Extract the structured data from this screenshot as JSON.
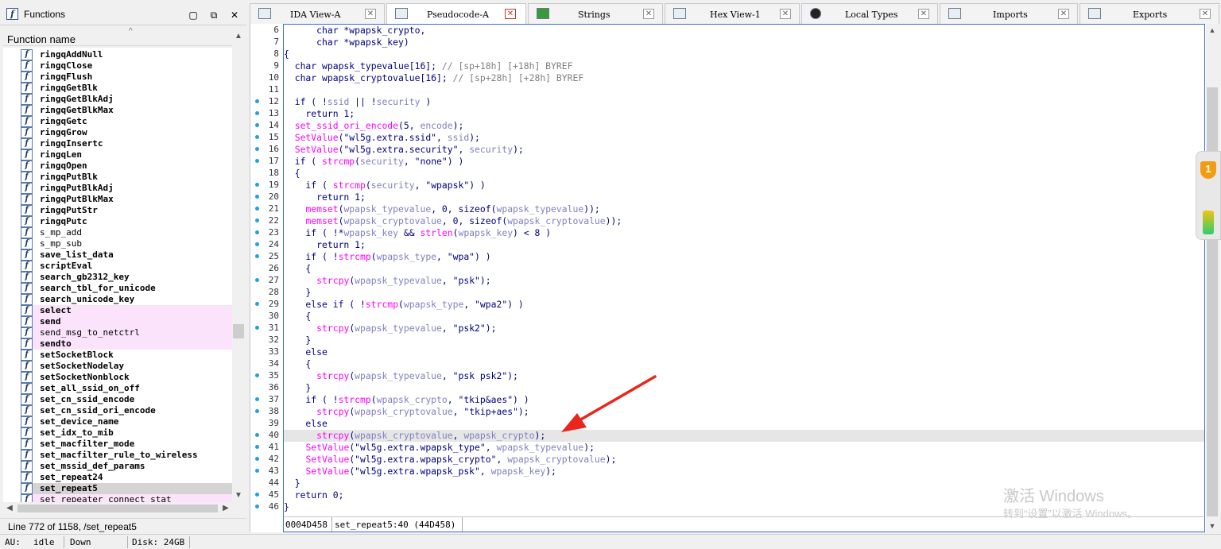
{
  "functions_panel": {
    "title": "Functions",
    "column_header": "Function name",
    "status": "Line 772 of 1158, /set_repeat5",
    "items": [
      {
        "name": "ringqAddNull",
        "lib": false,
        "style": ""
      },
      {
        "name": "ringqClose",
        "lib": false,
        "style": ""
      },
      {
        "name": "ringqFlush",
        "lib": false,
        "style": ""
      },
      {
        "name": "ringqGetBlk",
        "lib": false,
        "style": ""
      },
      {
        "name": "ringqGetBlkAdj",
        "lib": false,
        "style": ""
      },
      {
        "name": "ringqGetBlkMax",
        "lib": false,
        "style": ""
      },
      {
        "name": "ringqGetc",
        "lib": false,
        "style": ""
      },
      {
        "name": "ringqGrow",
        "lib": false,
        "style": ""
      },
      {
        "name": "ringqInsertc",
        "lib": false,
        "style": ""
      },
      {
        "name": "ringqLen",
        "lib": false,
        "style": ""
      },
      {
        "name": "ringqOpen",
        "lib": false,
        "style": ""
      },
      {
        "name": "ringqPutBlk",
        "lib": false,
        "style": ""
      },
      {
        "name": "ringqPutBlkAdj",
        "lib": false,
        "style": ""
      },
      {
        "name": "ringqPutBlkMax",
        "lib": false,
        "style": ""
      },
      {
        "name": "ringqPutStr",
        "lib": false,
        "style": ""
      },
      {
        "name": "ringqPutc",
        "lib": false,
        "style": ""
      },
      {
        "name": "s_mp_add",
        "lib": true,
        "style": ""
      },
      {
        "name": "s_mp_sub",
        "lib": true,
        "style": ""
      },
      {
        "name": "save_list_data",
        "lib": false,
        "style": ""
      },
      {
        "name": "scriptEval",
        "lib": false,
        "style": ""
      },
      {
        "name": "search_gb2312_key",
        "lib": false,
        "style": ""
      },
      {
        "name": "search_tbl_for_unicode",
        "lib": false,
        "style": ""
      },
      {
        "name": "search_unicode_key",
        "lib": false,
        "style": ""
      },
      {
        "name": "select",
        "lib": false,
        "style": "pink"
      },
      {
        "name": "send",
        "lib": false,
        "style": "pink"
      },
      {
        "name": "send_msg_to_netctrl",
        "lib": true,
        "style": "pink"
      },
      {
        "name": "sendto",
        "lib": false,
        "style": "pink"
      },
      {
        "name": "setSocketBlock",
        "lib": false,
        "style": ""
      },
      {
        "name": "setSocketNodelay",
        "lib": false,
        "style": ""
      },
      {
        "name": "setSocketNonblock",
        "lib": false,
        "style": ""
      },
      {
        "name": "set_all_ssid_on_off",
        "lib": false,
        "style": ""
      },
      {
        "name": "set_cn_ssid_encode",
        "lib": false,
        "style": ""
      },
      {
        "name": "set_cn_ssid_ori_encode",
        "lib": false,
        "style": ""
      },
      {
        "name": "set_device_name",
        "lib": false,
        "style": ""
      },
      {
        "name": "set_idx_to_mib",
        "lib": false,
        "style": ""
      },
      {
        "name": "set_macfilter_mode",
        "lib": false,
        "style": ""
      },
      {
        "name": "set_macfilter_rule_to_wireless",
        "lib": false,
        "style": ""
      },
      {
        "name": "set_mssid_def_params",
        "lib": false,
        "style": ""
      },
      {
        "name": "set_repeat24",
        "lib": false,
        "style": ""
      },
      {
        "name": "set_repeat5",
        "lib": false,
        "style": "sel"
      },
      {
        "name": "set_repeater_connect_stat",
        "lib": true,
        "style": "pink"
      }
    ]
  },
  "tabs": [
    {
      "label": "IDA View-A",
      "active": false
    },
    {
      "label": "Pseudocode-A",
      "active": true
    },
    {
      "label": "Strings",
      "active": false
    },
    {
      "label": "Hex View-1",
      "active": false
    },
    {
      "label": "Local Types",
      "active": false
    },
    {
      "label": "Imports",
      "active": false
    },
    {
      "label": "Exports",
      "active": false
    }
  ],
  "code": {
    "highlight_line": 40,
    "lines": [
      {
        "n": 6,
        "bp": false,
        "t": "      char *wpapsk_crypto,"
      },
      {
        "n": 7,
        "bp": false,
        "t": "      char *wpapsk_key)"
      },
      {
        "n": 8,
        "bp": false,
        "t": "{"
      },
      {
        "n": 9,
        "bp": false,
        "t": "  char wpapsk_typevalue[16]; // [sp+18h] [+18h] BYREF"
      },
      {
        "n": 10,
        "bp": false,
        "t": "  char wpapsk_cryptovalue[16]; // [sp+28h] [+28h] BYREF"
      },
      {
        "n": 11,
        "bp": false,
        "t": ""
      },
      {
        "n": 12,
        "bp": true,
        "t": "  if ( !ssid || !security )"
      },
      {
        "n": 13,
        "bp": true,
        "t": "    return 1;"
      },
      {
        "n": 14,
        "bp": true,
        "t": "  set_ssid_ori_encode(5, encode);"
      },
      {
        "n": 15,
        "bp": true,
        "t": "  SetValue(\"wl5g.extra.ssid\", ssid);"
      },
      {
        "n": 16,
        "bp": true,
        "t": "  SetValue(\"wl5g.extra.security\", security);"
      },
      {
        "n": 17,
        "bp": true,
        "t": "  if ( strcmp(security, \"none\") )"
      },
      {
        "n": 18,
        "bp": false,
        "t": "  {"
      },
      {
        "n": 19,
        "bp": true,
        "t": "    if ( strcmp(security, \"wpapsk\") )"
      },
      {
        "n": 20,
        "bp": true,
        "t": "      return 1;"
      },
      {
        "n": 21,
        "bp": true,
        "t": "    memset(wpapsk_typevalue, 0, sizeof(wpapsk_typevalue));"
      },
      {
        "n": 22,
        "bp": true,
        "t": "    memset(wpapsk_cryptovalue, 0, sizeof(wpapsk_cryptovalue));"
      },
      {
        "n": 23,
        "bp": true,
        "t": "    if ( !*wpapsk_key && strlen(wpapsk_key) < 8 )"
      },
      {
        "n": 24,
        "bp": true,
        "t": "      return 1;"
      },
      {
        "n": 25,
        "bp": true,
        "t": "    if ( !strcmp(wpapsk_type, \"wpa\") )"
      },
      {
        "n": 26,
        "bp": false,
        "t": "    {"
      },
      {
        "n": 27,
        "bp": true,
        "t": "      strcpy(wpapsk_typevalue, \"psk\");"
      },
      {
        "n": 28,
        "bp": false,
        "t": "    }"
      },
      {
        "n": 29,
        "bp": true,
        "t": "    else if ( !strcmp(wpapsk_type, \"wpa2\") )"
      },
      {
        "n": 30,
        "bp": false,
        "t": "    {"
      },
      {
        "n": 31,
        "bp": true,
        "t": "      strcpy(wpapsk_typevalue, \"psk2\");"
      },
      {
        "n": 32,
        "bp": false,
        "t": "    }"
      },
      {
        "n": 33,
        "bp": false,
        "t": "    else"
      },
      {
        "n": 34,
        "bp": false,
        "t": "    {"
      },
      {
        "n": 35,
        "bp": true,
        "t": "      strcpy(wpapsk_typevalue, \"psk psk2\");"
      },
      {
        "n": 36,
        "bp": false,
        "t": "    }"
      },
      {
        "n": 37,
        "bp": true,
        "t": "    if ( !strcmp(wpapsk_crypto, \"tkip&aes\") )"
      },
      {
        "n": 38,
        "bp": true,
        "t": "      strcpy(wpapsk_cryptovalue, \"tkip+aes\");"
      },
      {
        "n": 39,
        "bp": false,
        "t": "    else"
      },
      {
        "n": 40,
        "bp": true,
        "t": "      strcpy(wpapsk_cryptovalue, wpapsk_crypto);"
      },
      {
        "n": 41,
        "bp": true,
        "t": "    SetValue(\"wl5g.extra.wpapsk_type\", wpapsk_typevalue);"
      },
      {
        "n": 42,
        "bp": true,
        "t": "    SetValue(\"wl5g.extra.wpapsk_crypto\", wpapsk_cryptovalue);"
      },
      {
        "n": 43,
        "bp": true,
        "t": "    SetValue(\"wl5g.extra.wpapsk_psk\", wpapsk_key);"
      },
      {
        "n": 44,
        "bp": false,
        "t": "  }"
      },
      {
        "n": 45,
        "bp": true,
        "t": "  return 0;"
      },
      {
        "n": 46,
        "bp": true,
        "t": "}"
      }
    ],
    "status_addr": "0004D458",
    "status_pos": "set_repeat5:40 (44D458)"
  },
  "watermark": {
    "line1": "激活 Windows",
    "line2": "转到“设置”以激活 Windows。"
  },
  "side_widget": {
    "badge": "1"
  },
  "bottom_status": {
    "au_label": "AU:",
    "au_value": "idle",
    "direction": "Down",
    "disk": "Disk: 24GB"
  },
  "colors": {
    "accent_border": "#3b6fd6",
    "breakpoint_dot": "#25a0d8",
    "func_call": "#ff00ff",
    "comment": "#808080",
    "annotation_arrow": "#e8261c"
  }
}
